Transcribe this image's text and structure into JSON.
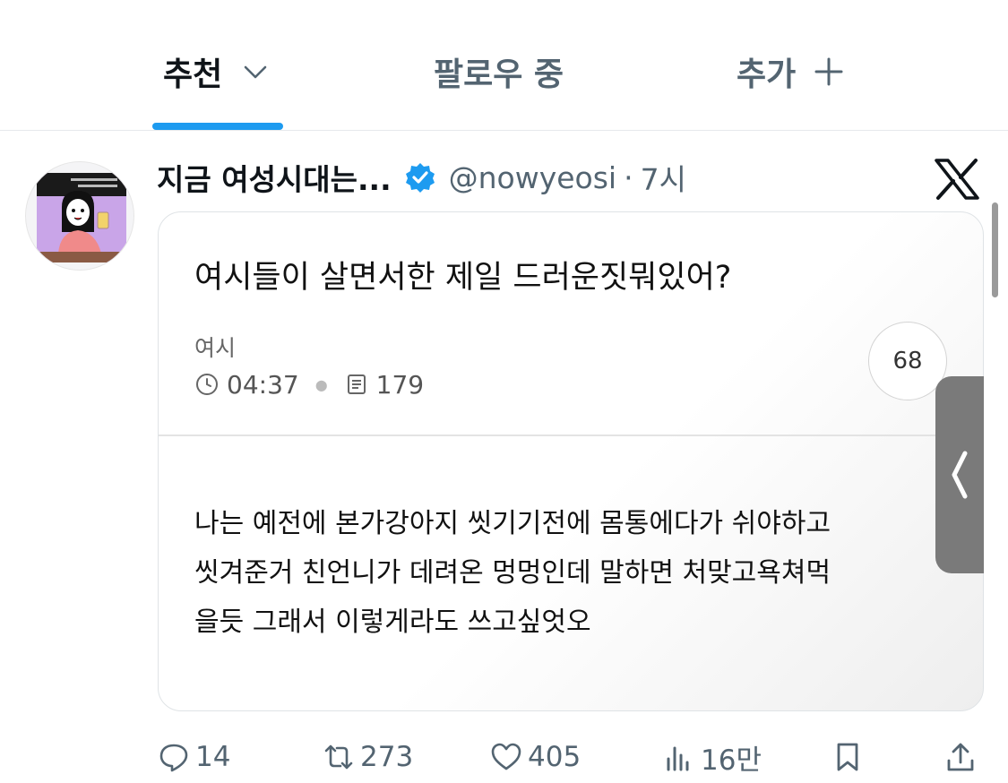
{
  "tabs": {
    "recommended": "추천",
    "following": "팔로우 중",
    "add": "추가"
  },
  "post": {
    "display_name": "지금 여성시대는...",
    "handle": "@nowyeosi",
    "separator": "·",
    "time": "7시",
    "card": {
      "title": "여시들이 살면서한 제일 드러운짓뭐있어?",
      "category": "여시",
      "clock_time": "04:37",
      "views": "179",
      "comments": "68",
      "body_lines": [
        "나는 예전에 본가강아지 씻기기전에 몸통에다가 쉬야하고",
        "씻겨준거 친언니가 데려온 멍멍인데 말하면 처맞고욕쳐먹",
        "을듯 그래서 이렇게라도 쓰고싶엇오"
      ]
    },
    "actions": {
      "replies": "14",
      "retweets": "273",
      "likes": "405",
      "views": "16만"
    }
  },
  "colors": {
    "accent": "#1d9bf0",
    "text_primary": "#0f1419",
    "text_secondary": "#536471",
    "handle_gray": "#7a7a7a"
  },
  "icons": [
    "chevron-down-icon",
    "plus-icon",
    "verified-badge-icon",
    "x-logo-icon",
    "clock-icon",
    "document-icon",
    "chevron-left-icon",
    "reply-icon",
    "retweet-icon",
    "heart-icon",
    "views-icon",
    "bookmark-icon",
    "share-icon"
  ]
}
